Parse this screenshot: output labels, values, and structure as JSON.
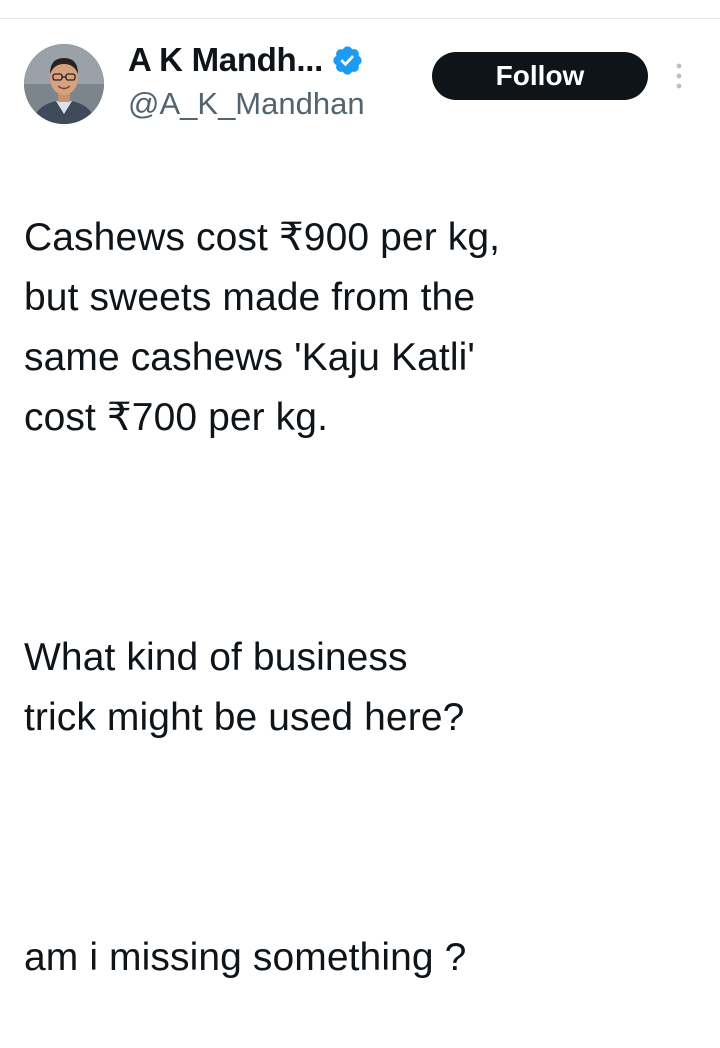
{
  "author": {
    "display_name": "A K Mandh...",
    "handle": "@A_K_Mandhan",
    "verified": true,
    "verified_color": "#1d9bf0"
  },
  "actions": {
    "follow_label": "Follow"
  },
  "tweet": {
    "paragraphs": [
      "Cashews cost ₹900 per kg,\nbut sweets made from the\nsame cashews 'Kaju Katli'\ncost ₹700 per kg.",
      "What kind of business\ntrick might be used here?",
      "am i missing something ?"
    ]
  },
  "icons": {
    "verified": "verified-badge-icon",
    "more": "more-options-icon"
  }
}
